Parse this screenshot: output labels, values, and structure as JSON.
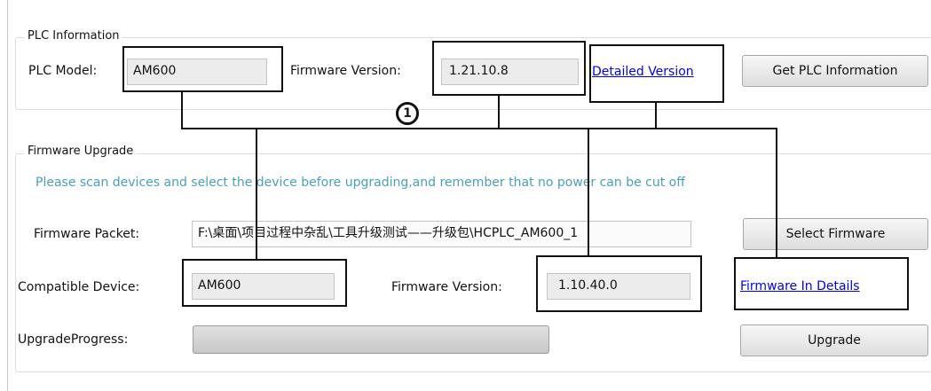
{
  "plc_info": {
    "group_title": "PLC Information",
    "model_label": "PLC Model:",
    "model_value": "AM600",
    "fw_label": "Firmware Version:",
    "fw_value": "1.21.10.8",
    "detail_link": "Detailed Version",
    "get_button": "Get PLC Information"
  },
  "firmware_upgrade": {
    "group_title": "Firmware Upgrade",
    "hint": "Please scan devices and select the device before upgrading,and remember that no power can be cut off",
    "packet_label": "Firmware Packet:",
    "packet_value": "F:\\桌面\\项目过程中杂乱\\工具升级测试——升级包\\HCPLC_AM600_1",
    "select_button": "Select Firmware",
    "device_label": "Compatible Device:",
    "device_value": "AM600",
    "fw_label": "Firmware Version:",
    "fw_value": "1.10.40.0",
    "details_link": "Firmware In Details",
    "progress_label": "UpgradeProgress:",
    "progress_value": 0,
    "upgrade_button": "Upgrade"
  },
  "annotation": {
    "badge": "1"
  }
}
